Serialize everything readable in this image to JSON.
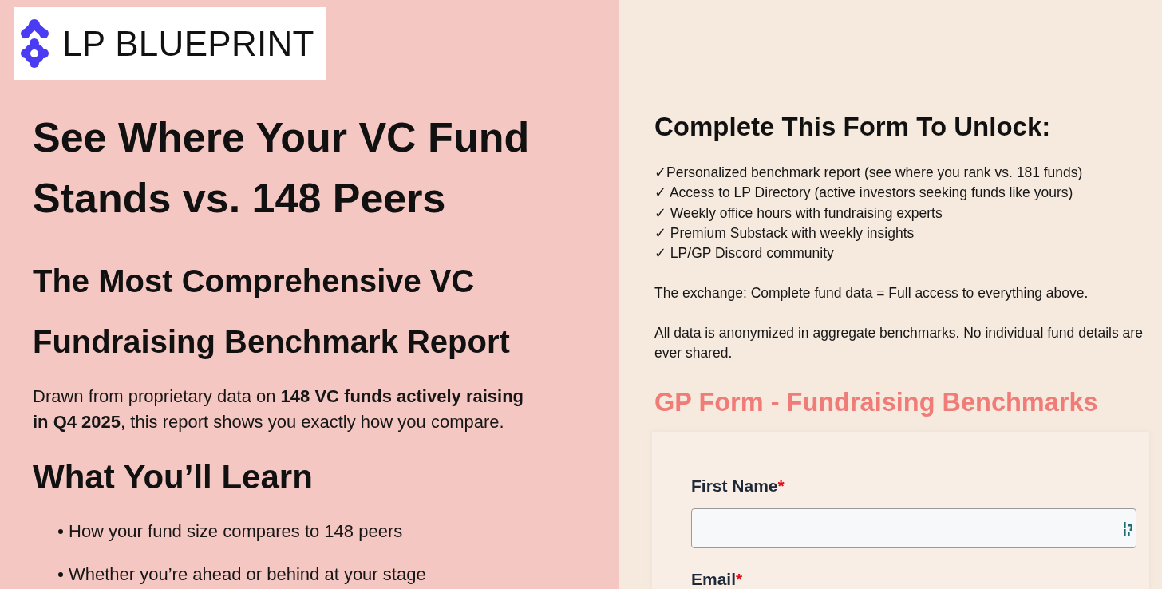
{
  "logo": {
    "text": "LP BLUEPRINT"
  },
  "hero": {
    "title": "See Where Your VC Fund Stands vs. 148 Peers",
    "subtitle": "The Most Comprehensive VC Fundraising Benchmark Report",
    "intro": "Drawn from proprietary data on **148 VC funds actively raising in Q4 2025**, this report shows you exactly how you compare."
  },
  "learn": {
    "heading": "What You’ll Learn",
    "items": [
      "How your fund size compares to 148 peers",
      "Whether you’re ahead or behind at your stage"
    ]
  },
  "unlock": {
    "heading": "Complete This Form To Unlock:",
    "benefits": [
      "✓Personalized benchmark report (see where you rank vs. 181 funds)",
      "✓ Access to LP Directory (active investors seeking funds like yours)",
      "✓ Weekly office hours with fundraising experts",
      "✓ Premium Substack with weekly insights",
      "✓ LP/GP Discord community"
    ],
    "exchange": "The exchange: Complete fund data = Full access to everything above.",
    "privacy": "All data is anonymized in aggregate benchmarks. No individual fund details are ever shared."
  },
  "form": {
    "title": "GP Form - Fundraising Benchmarks",
    "fields": [
      {
        "label": "First Name",
        "required_mark": "*",
        "input_shown": true
      },
      {
        "label": "Email",
        "required_mark": "*",
        "input_shown": false
      }
    ]
  }
}
